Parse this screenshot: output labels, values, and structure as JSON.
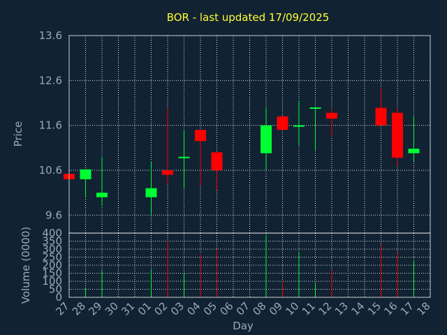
{
  "colors": {
    "background": "#112233",
    "up": "#00ff33",
    "down": "#ff0000",
    "title": "#ffff33",
    "text": "#99aabb"
  },
  "chart_data": {
    "type": "candlestick",
    "title": "BOR - last updated 17/09/2025",
    "price_axis": {
      "label": "Price",
      "ylim": [
        9.2,
        13.6
      ],
      "ticks": [
        "9.6",
        "10.6",
        "11.6",
        "12.6",
        "13.6"
      ]
    },
    "volume_axis": {
      "label": "Volume (0000)",
      "ylim": [
        0,
        400
      ],
      "ticks": [
        "0",
        "50",
        "100",
        "150",
        "200",
        "250",
        "300",
        "350",
        "400"
      ]
    },
    "xlabel": "Day",
    "x_ticks": [
      "27",
      "28",
      "29",
      "30",
      "31",
      "01",
      "02",
      "03",
      "04",
      "05",
      "06",
      "07",
      "08",
      "09",
      "10",
      "11",
      "12",
      "13",
      "14",
      "15",
      "16",
      "17",
      "18"
    ],
    "grid": true,
    "candles": [
      {
        "day": "27",
        "open": 10.52,
        "high": 10.52,
        "low": 10.4,
        "close": 10.4,
        "volume": 0
      },
      {
        "day": "28",
        "open": 10.4,
        "high": 10.62,
        "low": 10.0,
        "close": 10.62,
        "volume": 60
      },
      {
        "day": "29",
        "open": 10.0,
        "high": 10.9,
        "low": 9.8,
        "close": 10.1,
        "volume": 170
      },
      {
        "day": "01",
        "open": 10.0,
        "high": 10.8,
        "low": 9.6,
        "close": 10.2,
        "volume": 170
      },
      {
        "day": "02",
        "open": 10.6,
        "high": 11.99,
        "low": 10.3,
        "close": 10.5,
        "volume": 350
      },
      {
        "day": "03",
        "open": 10.9,
        "high": 11.5,
        "low": 10.2,
        "close": 10.9,
        "volume": 150
      },
      {
        "day": "04",
        "open": 11.5,
        "high": 11.5,
        "low": 10.25,
        "close": 11.25,
        "volume": 270
      },
      {
        "day": "05",
        "open": 11.0,
        "high": 11.0,
        "low": 10.15,
        "close": 10.6,
        "volume": 300
      },
      {
        "day": "08",
        "open": 10.98,
        "high": 11.99,
        "low": 10.6,
        "close": 11.6,
        "volume": 390
      },
      {
        "day": "09",
        "open": 11.8,
        "high": 11.8,
        "low": 11.5,
        "close": 11.5,
        "volume": 100
      },
      {
        "day": "10",
        "open": 11.58,
        "high": 12.15,
        "low": 11.15,
        "close": 11.6,
        "volume": 280
      },
      {
        "day": "11",
        "open": 11.98,
        "high": 12.0,
        "low": 11.05,
        "close": 12.0,
        "volume": 90
      },
      {
        "day": "12",
        "open": 11.88,
        "high": 11.98,
        "low": 11.35,
        "close": 11.75,
        "volume": 170
      },
      {
        "day": "15",
        "open": 11.99,
        "high": 12.45,
        "low": 11.6,
        "close": 11.6,
        "volume": 330
      },
      {
        "day": "16",
        "open": 11.88,
        "high": 11.99,
        "low": 10.7,
        "close": 10.88,
        "volume": 280
      },
      {
        "day": "17",
        "open": 10.98,
        "high": 11.8,
        "low": 10.8,
        "close": 11.08,
        "volume": 230
      }
    ]
  }
}
